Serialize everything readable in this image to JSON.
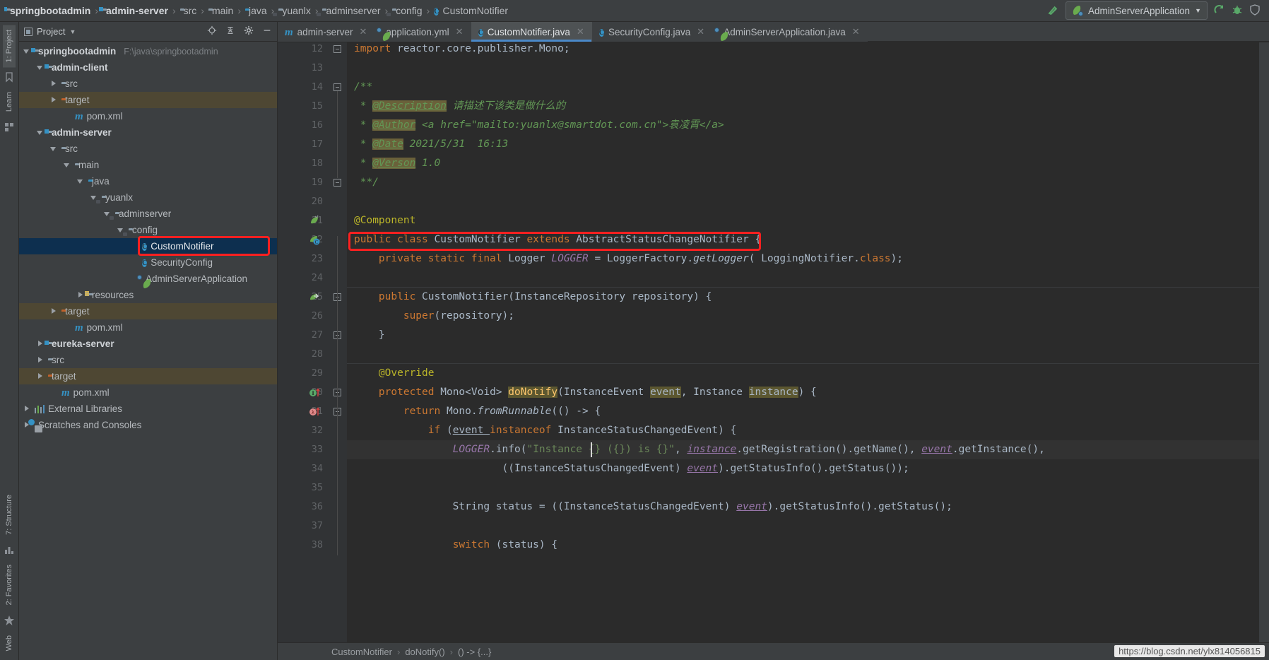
{
  "navbar": {
    "breadcrumbs": [
      {
        "label": "springbootadmin",
        "icon": "module-folder-icon",
        "bold": true
      },
      {
        "label": "admin-server",
        "icon": "module-folder-icon",
        "bold": true
      },
      {
        "label": "src",
        "icon": "folder-icon",
        "bold": false
      },
      {
        "label": "main",
        "icon": "folder-icon",
        "bold": false
      },
      {
        "label": "java",
        "icon": "source-folder-icon",
        "bold": false
      },
      {
        "label": "yuanlx",
        "icon": "package-icon",
        "bold": false
      },
      {
        "label": "adminserver",
        "icon": "package-icon",
        "bold": false
      },
      {
        "label": "config",
        "icon": "package-icon",
        "bold": false
      },
      {
        "label": "CustomNotifier",
        "icon": "class-icon",
        "bold": false
      }
    ],
    "separator": "›",
    "run_configuration": "AdminServerApplication",
    "icons": [
      "build-hammer-icon",
      "run-icon",
      "debug-icon",
      "coverage-icon"
    ]
  },
  "left_strip": {
    "tabs": [
      {
        "label": "1: Project",
        "selected": true
      },
      {
        "label": "Learn",
        "selected": false
      },
      {
        "label": "7: Structure",
        "selected": false
      },
      {
        "label": "2: Favorites",
        "selected": false
      },
      {
        "label": "Web",
        "selected": false
      }
    ]
  },
  "project_panel": {
    "title": "Project",
    "toolbar_icons": [
      "locate-icon",
      "collapse-all-icon",
      "settings-gear-icon",
      "hide-icon"
    ],
    "tree": [
      {
        "depth": 0,
        "arrow": "down",
        "icon": "module-folder-icon",
        "label": "springbootadmin",
        "bold": true,
        "path": "F:\\java\\springbootadmin",
        "state": "normal"
      },
      {
        "depth": 1,
        "arrow": "down",
        "icon": "module-folder-icon",
        "label": "admin-client",
        "bold": true,
        "path": "",
        "state": "normal"
      },
      {
        "depth": 2,
        "arrow": "right",
        "icon": "folder-icon",
        "label": "src",
        "bold": false,
        "path": "",
        "state": "normal"
      },
      {
        "depth": 2,
        "arrow": "right",
        "icon": "target-folder-icon",
        "label": "target",
        "bold": false,
        "path": "",
        "state": "target"
      },
      {
        "depth": 3,
        "arrow": "none",
        "icon": "maven-icon",
        "label": "pom.xml",
        "bold": false,
        "path": "",
        "state": "normal"
      },
      {
        "depth": 1,
        "arrow": "down",
        "icon": "module-folder-icon",
        "label": "admin-server",
        "bold": true,
        "path": "",
        "state": "normal"
      },
      {
        "depth": 2,
        "arrow": "down",
        "icon": "folder-icon",
        "label": "src",
        "bold": false,
        "path": "",
        "state": "normal"
      },
      {
        "depth": 3,
        "arrow": "down",
        "icon": "folder-icon",
        "label": "main",
        "bold": false,
        "path": "",
        "state": "normal"
      },
      {
        "depth": 4,
        "arrow": "down",
        "icon": "source-folder-icon",
        "label": "java",
        "bold": false,
        "path": "",
        "state": "normal"
      },
      {
        "depth": 5,
        "arrow": "down",
        "icon": "package-icon",
        "label": "yuanlx",
        "bold": false,
        "path": "",
        "state": "normal"
      },
      {
        "depth": 6,
        "arrow": "down",
        "icon": "package-icon",
        "label": "adminserver",
        "bold": false,
        "path": "",
        "state": "normal"
      },
      {
        "depth": 7,
        "arrow": "down",
        "icon": "package-icon",
        "label": "config",
        "bold": false,
        "path": "",
        "state": "normal"
      },
      {
        "depth": 8,
        "arrow": "none",
        "icon": "class-icon",
        "label": "CustomNotifier",
        "bold": false,
        "path": "",
        "state": "selected"
      },
      {
        "depth": 8,
        "arrow": "none",
        "icon": "class-icon",
        "label": "SecurityConfig",
        "bold": false,
        "path": "",
        "state": "normal"
      },
      {
        "depth": 8,
        "arrow": "none",
        "icon": "spring-class-icon",
        "label": "AdminServerApplication",
        "bold": false,
        "path": "",
        "state": "normal"
      },
      {
        "depth": 4,
        "arrow": "right",
        "icon": "resources-folder-icon",
        "label": "resources",
        "bold": false,
        "path": "",
        "state": "normal"
      },
      {
        "depth": 2,
        "arrow": "right",
        "icon": "target-folder-icon",
        "label": "target",
        "bold": false,
        "path": "",
        "state": "target"
      },
      {
        "depth": 3,
        "arrow": "none",
        "icon": "maven-icon",
        "label": "pom.xml",
        "bold": false,
        "path": "",
        "state": "normal"
      },
      {
        "depth": 1,
        "arrow": "right",
        "icon": "module-folder-icon",
        "label": "eureka-server",
        "bold": true,
        "path": "",
        "state": "normal"
      },
      {
        "depth": 1,
        "arrow": "right",
        "icon": "folder-icon",
        "label": "src",
        "bold": false,
        "path": "",
        "state": "normal"
      },
      {
        "depth": 1,
        "arrow": "right",
        "icon": "target-folder-icon",
        "label": "target",
        "bold": false,
        "path": "",
        "state": "target"
      },
      {
        "depth": 2,
        "arrow": "none",
        "icon": "maven-icon",
        "label": "pom.xml",
        "bold": false,
        "path": "",
        "state": "normal"
      },
      {
        "depth": 0,
        "arrow": "right",
        "icon": "external-libraries-icon",
        "label": "External Libraries",
        "bold": false,
        "path": "",
        "state": "normal"
      },
      {
        "depth": 0,
        "arrow": "right",
        "icon": "scratches-icon",
        "label": "Scratches and Consoles",
        "bold": false,
        "path": "",
        "state": "normal"
      }
    ]
  },
  "editor": {
    "tabs": [
      {
        "label": "admin-server",
        "icon": "maven-icon",
        "active": false
      },
      {
        "label": "application.yml",
        "icon": "spring-yaml-icon",
        "active": false
      },
      {
        "label": "CustomNotifier.java",
        "icon": "class-icon",
        "active": true
      },
      {
        "label": "SecurityConfig.java",
        "icon": "class-icon",
        "active": false
      },
      {
        "label": "AdminServerApplication.java",
        "icon": "spring-class-icon",
        "active": false
      }
    ],
    "first_line_number": 12,
    "lines": [
      {
        "n": 12,
        "html": "<span class=\"kw\">import</span> reactor.core.publisher.Mono;",
        "indent": 0
      },
      {
        "n": 13,
        "html": "",
        "indent": 0
      },
      {
        "n": 14,
        "html": "<span class=\"cmt\">/**</span>",
        "indent": 0
      },
      {
        "n": 15,
        "html": "<span class=\"cmt\"> * </span><span class=\"cmtt\">@Description</span><span class=\"cmt\"> 请描述下该类是做什么的</span>",
        "indent": 0
      },
      {
        "n": 16,
        "html": "<span class=\"cmt\"> * </span><span class=\"cmtt\">@Author</span><span class=\"cmt\"> &lt;a href=\"mailto:yuanlx@smartdot.com.cn\"&gt;袁凌霄&lt;/a&gt;</span>",
        "indent": 0
      },
      {
        "n": 17,
        "html": "<span class=\"cmt\"> * </span><span class=\"cmtt\">@Date</span><span class=\"cmt\"> 2021/5/31  16:13</span>",
        "indent": 0
      },
      {
        "n": 18,
        "html": "<span class=\"cmt\"> * </span><span class=\"cmtt\">@Verson</span><span class=\"cmt\"> 1.0</span>",
        "indent": 0
      },
      {
        "n": 19,
        "html": "<span class=\"cmt\"> **/</span>",
        "indent": 0
      },
      {
        "n": 20,
        "html": "",
        "indent": 0
      },
      {
        "n": 21,
        "html": "<span class=\"ann\">@Component</span>",
        "indent": 0
      },
      {
        "n": 22,
        "html": "<span class=\"kw\">public class </span>CustomNotifier <span class=\"kw\">extends </span>AbstractStatusChangeNotifier {",
        "indent": 0
      },
      {
        "n": 23,
        "html": "    <span class=\"kw\">private static final </span>Logger <span class=\"fld\">LOGGER </span>= LoggerFactory.<span class=\"sfn\">getLogger</span>( LoggingNotifier.<span class=\"kw\">class</span>);",
        "indent": 0
      },
      {
        "n": 24,
        "html": "",
        "indent": 0
      },
      {
        "n": 25,
        "html": "    <span class=\"kw\">public </span>CustomNotifier(InstanceRepository repository) {",
        "indent": 0
      },
      {
        "n": 26,
        "html": "        <span class=\"kw\">super</span>(repository);",
        "indent": 0
      },
      {
        "n": 27,
        "html": "    }",
        "indent": 0
      },
      {
        "n": 28,
        "html": "",
        "indent": 0
      },
      {
        "n": 29,
        "html": "    <span class=\"ann\">@Override</span>",
        "indent": 0
      },
      {
        "n": 30,
        "html": "    <span class=\"kw\">protected </span>Mono&lt;Void&gt; <span class=\"mtd hl\">doNotify</span>(InstanceEvent <span class=\"hl\">event</span>, Instance <span class=\"hl\">instance</span>) {",
        "indent": 0
      },
      {
        "n": 31,
        "html": "        <span class=\"kw\">return </span>Mono.<span class=\"sfn\">fromRunnable</span>(() -&gt; {",
        "indent": 0
      },
      {
        "n": 32,
        "html": "            <span class=\"kw\">if </span>(<span class=\"uline\">event </span><span class=\"kw\">instanceof </span>InstanceStatusChangedEvent) {",
        "indent": 0
      },
      {
        "n": 33,
        "html": "                <span class=\"fld\">LOGGER</span>.info(<span class=\"str\">\"Instance {} ({}) is {}\"</span>, <span class=\"uline fld\">instance</span>.getRegistration().getName(), <span class=\"uline fld\">event</span>.getInstance(),",
        "indent": 0
      },
      {
        "n": 34,
        "html": "                        ((InstanceStatusChangedEvent) <span class=\"uline fld\">event</span>).getStatusInfo().getStatus());",
        "indent": 0
      },
      {
        "n": 35,
        "html": "",
        "indent": 0
      },
      {
        "n": 36,
        "html": "                String status = ((InstanceStatusChangedEvent) <span class=\"uline fld\">event</span>).getStatusInfo().getStatus();",
        "indent": 0
      },
      {
        "n": 37,
        "html": "",
        "indent": 0
      },
      {
        "n": 38,
        "html": "                <span class=\"kw\">switch </span>(status) {",
        "indent": 0
      }
    ],
    "breadcrumb": [
      "CustomNotifier",
      "doNotify()",
      "() -> {...}"
    ],
    "breadcrumb_separator": "›",
    "gutter_icons": [
      {
        "line": 21,
        "icon": "spring-bean-icon"
      },
      {
        "line": 22,
        "icon": "spring-class-bean-icon"
      },
      {
        "line": 25,
        "icon": "spring-autowire-icon"
      },
      {
        "line": 30,
        "icon": "implementing-method-icon"
      },
      {
        "line": 31,
        "icon": "lambda-icon"
      }
    ]
  },
  "annotations": {
    "red_boxes": [
      {
        "name": "tree-selected-class-highlight"
      },
      {
        "name": "class-declaration-highlight"
      }
    ]
  },
  "watermark": "https://blog.csdn.net/ylx814056815",
  "colors": {
    "accent_blue": "#3592c4",
    "tab_underline": "#4a88c7",
    "selection_blue": "#0d2f4f",
    "target_brown": "#4e4733",
    "annotation_red": "#ff2020",
    "editor_bg": "#2b2b2b",
    "panel_bg": "#3c3f41"
  }
}
